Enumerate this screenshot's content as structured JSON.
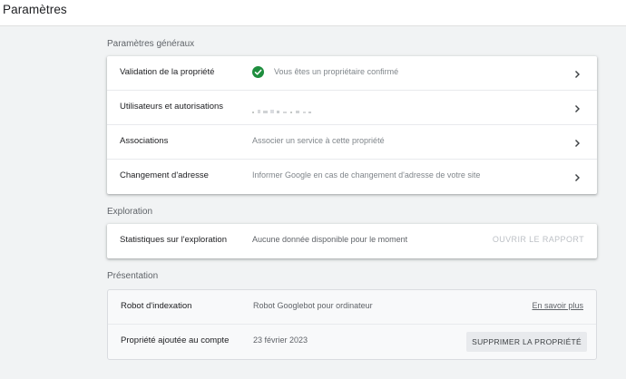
{
  "header": {
    "title": "Paramètres"
  },
  "sections": {
    "general": {
      "label": "Paramètres généraux",
      "rows": [
        {
          "title": "Validation de la propriété",
          "value": "Vous êtes un propriétaire confirmé",
          "icon": "check-circle-icon"
        },
        {
          "title": "Utilisateurs et autorisations",
          "value": ""
        },
        {
          "title": "Associations",
          "value": "Associer un service à cette propriété"
        },
        {
          "title": "Changement d'adresse",
          "value": "Informer Google en cas de changement d'adresse de votre site"
        }
      ]
    },
    "exploration": {
      "label": "Exploration",
      "rows": [
        {
          "title": "Statistiques sur l'exploration",
          "value": "Aucune donnée disponible pour le moment",
          "action": "OUVRIR LE RAPPORT"
        }
      ]
    },
    "presentation": {
      "label": "Présentation",
      "rows": [
        {
          "title": "Robot d'indexation",
          "value": "Robot Googlebot pour ordinateur",
          "action": "En savoir plus"
        },
        {
          "title": "Propriété ajoutée au compte",
          "value": "23 février 2023",
          "action": "SUPPRIMER LA PROPRIÉTÉ"
        }
      ]
    }
  },
  "colors": {
    "background": "#f1f3f4",
    "check": "#1e8e3e",
    "disabled_action": "#bdc1c6"
  }
}
